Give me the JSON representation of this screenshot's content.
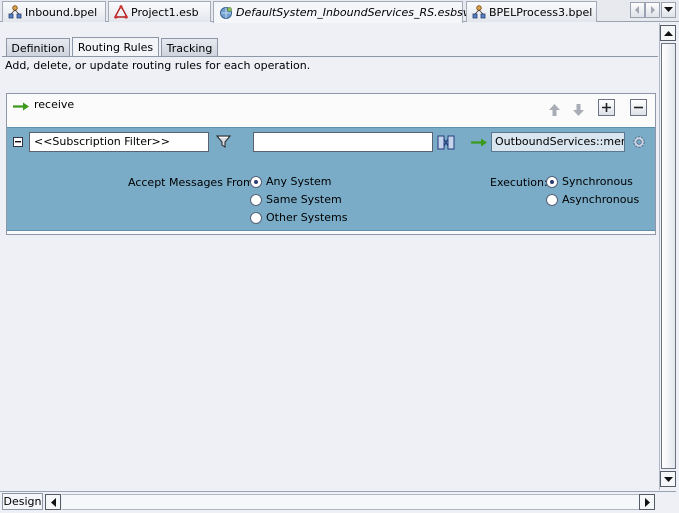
{
  "editor_tabs": [
    {
      "label": "Inbound.bpel",
      "icon": "bpel-process-icon"
    },
    {
      "label": "Project1.esb",
      "icon": "esb-project-icon"
    },
    {
      "label": "DefaultSystem_InboundServices_RS.esbsvc",
      "icon": "routing-service-icon"
    },
    {
      "label": "BPELProcess3.bpel",
      "icon": "bpel-process-icon"
    }
  ],
  "panel_tabs": {
    "definition": "Definition",
    "routing_rules": "Routing Rules",
    "tracking": "Tracking"
  },
  "active_panel_tab": "Routing Rules",
  "description": "Add, delete, or update routing rules for each operation.",
  "operation": {
    "name": "receive"
  },
  "rule": {
    "filter_value": "<<Subscription Filter>>",
    "transform_value": "",
    "target_service": "OutboundServices::merge",
    "accept_label": "Accept Messages From:",
    "accept_options": [
      "Any System",
      "Same System",
      "Other Systems"
    ],
    "accept_selected": "Any System",
    "execution_label": "Execution:",
    "execution_options": [
      "Synchronous",
      "Asynchronous"
    ],
    "execution_selected": "Synchronous"
  },
  "bottom_tabs": {
    "design": "Design"
  },
  "colors": {
    "rule_background": "#7aacc8",
    "arrow_green": "#3a9a1a"
  }
}
